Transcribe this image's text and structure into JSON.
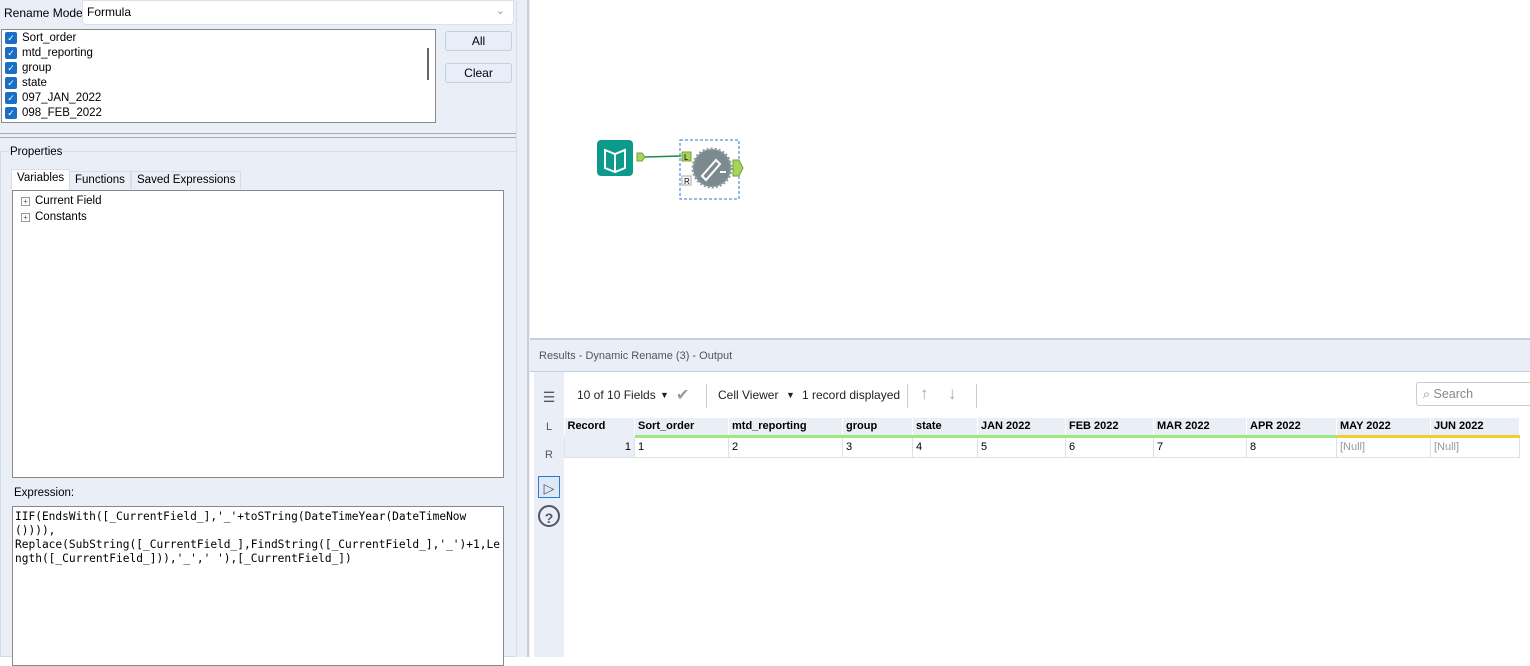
{
  "config": {
    "rename_mode_label": "Rename Mode:",
    "rename_mode_value": "Formula",
    "fields": [
      "Sort_order",
      "mtd_reporting",
      "group",
      "state",
      "097_JAN_2022",
      "098_FEB_2022"
    ],
    "all_button": "All",
    "clear_button": "Clear",
    "properties_label": "Properties",
    "tabs": [
      "Variables",
      "Functions",
      "Saved Expressions"
    ],
    "tree_items": [
      "Current Field",
      "Constants"
    ],
    "expression_label": "Expression:",
    "expression": "IIF(EndsWith([_CurrentField_],'_'+toSTring(DateTimeYear(DateTimeNow()))),\nReplace(SubString([_CurrentField_],FindString([_CurrentField_],'_')+1,Length([_CurrentField_])),'_',' '),[_CurrentField_])"
  },
  "canvas": {
    "anchor_left": "L",
    "anchor_right": "R"
  },
  "results": {
    "title": "Results - Dynamic Rename (3) - Output",
    "fields_selector": "10 of 10 Fields",
    "cell_viewer": "Cell Viewer",
    "record_count": "1 record displayed",
    "search_placeholder": "Search",
    "side_L": "L",
    "side_R": "R",
    "columns": [
      "Record",
      "Sort_order",
      "mtd_reporting",
      "group",
      "state",
      "JAN 2022",
      "FEB 2022",
      "MAR 2022",
      "APR 2022",
      "MAY 2022",
      "JUN 2022"
    ],
    "rows": [
      [
        "1",
        "1",
        "2",
        "3",
        "4",
        "5",
        "6",
        "7",
        "8",
        "[Null]",
        "[Null]"
      ]
    ]
  },
  "colors": {
    "accent": "#1a6fc4",
    "tool_teal": "#0c9a8a",
    "anchor_green": "#a6d45a"
  }
}
